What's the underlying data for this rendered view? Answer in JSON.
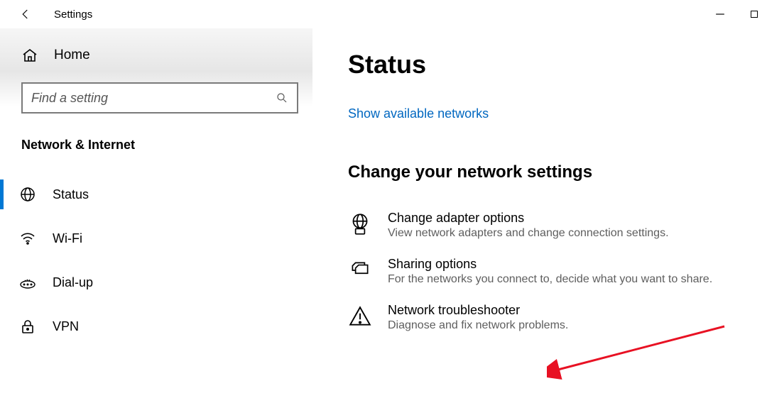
{
  "titlebar": {
    "title": "Settings"
  },
  "sidebar": {
    "home_label": "Home",
    "search_placeholder": "Find a setting",
    "category": "Network & Internet",
    "items": [
      {
        "label": "Status"
      },
      {
        "label": "Wi-Fi"
      },
      {
        "label": "Dial-up"
      },
      {
        "label": "VPN"
      }
    ]
  },
  "content": {
    "page_title": "Status",
    "link_available_networks": "Show available networks",
    "section_title": "Change your network settings",
    "options": [
      {
        "title": "Change adapter options",
        "desc": "View network adapters and change connection settings."
      },
      {
        "title": "Sharing options",
        "desc": "For the networks you connect to, decide what you want to share."
      },
      {
        "title": "Network troubleshooter",
        "desc": "Diagnose and fix network problems."
      }
    ]
  }
}
